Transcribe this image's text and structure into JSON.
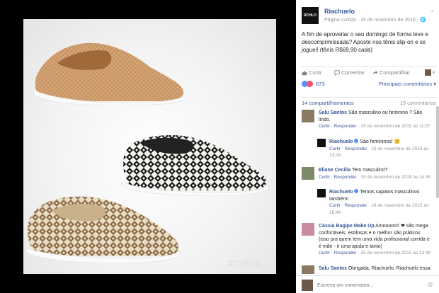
{
  "watermark": "RCHLO",
  "post": {
    "page_name": "Riachuelo",
    "page_avatar_text": "RCHLO",
    "meta": "Página curtida · 15 de novembro de 2015 · 🌐",
    "text": "A fim de aproveitar o seu domingo de forma leve e descomprimissada? Aposte nos tênis slip-on e se joguei! (tênis R$69,90 cada)"
  },
  "actions": {
    "like": "Curtir",
    "comment": "Comentar",
    "share": "Compartilhar"
  },
  "reactions": {
    "count": "673",
    "top_comments": "Principais comentários ▾"
  },
  "shares": {
    "shares_label": "14 compartilhamentos",
    "comments_label": "19 comentários"
  },
  "comments": [
    {
      "name": "Salu Santos",
      "text": "São masculino ou feminino ? São lindo.",
      "reply": "Curtir · Responder",
      "time": "· 15 de novembro de 2015 às 11:07"
    },
    {
      "name": "Riachuelo",
      "text": "São femininos! 🙂",
      "reply": "Curtir · Responder",
      "time": "· 16 de novembro de 2015 às 13:28"
    },
    {
      "name": "Eliane Cecília",
      "text": "Tem masculino?",
      "reply": "Curtir · Responder",
      "time": "· 15 de novembro de 2015 às 14:45"
    },
    {
      "name": "Riachuelo",
      "text": "Temos sapatos masculinos também!",
      "reply": "Curtir · Responder",
      "time": "· 18 de novembro de 2015 às 16:44"
    },
    {
      "name": "Cássia Bagipe Make Up",
      "text": "Amooooo!! ❤ são mega confortáveis, estilosos e o melhor são práticos (isso pra quem tem uma vida profissional corrida e é mãe - é uma ajuda e tanto)",
      "reply": "Curtir · Responder",
      "time": "· 15 de novembro de 2015 às 13:39"
    },
    {
      "name": "Salu Santos",
      "text": "Obrigada, Riachuelo. Riachuelo essa"
    }
  ],
  "composer": {
    "placeholder": "Escreva um comentário..."
  },
  "colors": {
    "link": "#365899",
    "meta": "#90949c",
    "like": "#5890ff",
    "love": "#f25268"
  }
}
